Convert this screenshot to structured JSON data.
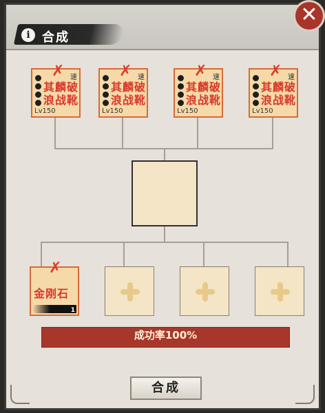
{
  "header": {
    "title": "合成",
    "info_icon": "i",
    "close_icon": "✕"
  },
  "materials": [
    {
      "name": "其麟破浪战靴",
      "level": "Lv150",
      "tag": "速",
      "marked": "✗"
    },
    {
      "name": "其麟破浪战靴",
      "level": "Lv150",
      "tag": "速",
      "marked": "✗"
    },
    {
      "name": "其麟破浪战靴",
      "level": "Lv150",
      "tag": "速",
      "marked": "✗"
    },
    {
      "name": "其麟破浪战靴",
      "level": "Lv150",
      "tag": "速",
      "marked": "✗"
    }
  ],
  "stone": {
    "name": "金刚石",
    "count": "1",
    "marked": "✗"
  },
  "rate_label": "成功率100%",
  "compose_button": "合成",
  "colors": {
    "accent_red": "#a8372b",
    "card_bg": "#f6d9a8",
    "card_border": "#d66a38",
    "text_red": "#d6392b"
  }
}
